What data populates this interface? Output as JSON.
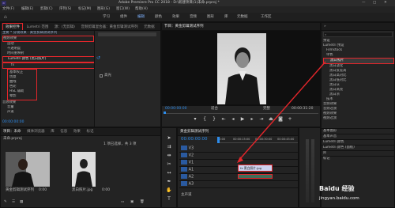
{
  "app": {
    "title": "Adobe Premiere Pro CC 2018 - D:\\新建项目(1)未命.prproj *",
    "window_controls": [
      "—",
      "□",
      "✕"
    ]
  },
  "menu": [
    "文件(F)",
    "编辑(E)",
    "剪辑(C)",
    "序列(S)",
    "标记(M)",
    "图形(G)",
    "窗口(W)",
    "帮助(H)"
  ],
  "workspaces": [
    "学习",
    "组件",
    "编辑",
    "颜色",
    "效果",
    "音频",
    "图形",
    "库",
    "元数据",
    "工作区"
  ],
  "effect_controls": {
    "tabs": [
      "效果控件",
      "Lumetri 范围",
      "源：(无剪辑)",
      "音频剪辑混合器：黄金剪辑测试序列",
      "元数据"
    ],
    "rows": [
      {
        "label": "主要 * 分镜效果 · 黄金剪辑测试序列",
        "indent": 0
      },
      {
        "label": "视频效果",
        "indent": 0
      },
      {
        "label": "运动",
        "indent": 1
      },
      {
        "label": "不透明度",
        "indent": 1
      },
      {
        "label": "时间重映射",
        "indent": 1
      },
      {
        "label": "Lumetri 颜色 (黑白照片)",
        "indent": 1
      },
      {
        "label": "fx",
        "indent": 2
      },
      {
        "label": "基本校正",
        "indent": 2
      },
      {
        "label": "创意",
        "indent": 2
      },
      {
        "label": "曲线",
        "indent": 2
      },
      {
        "label": "色轮",
        "indent": 2
      },
      {
        "label": "HSL 辅助",
        "indent": 2
      },
      {
        "label": "晕影",
        "indent": 2
      },
      {
        "label": "音频效果",
        "indent": 0
      },
      {
        "label": "音量",
        "indent": 1
      },
      {
        "label": "声道",
        "indent": 1
      }
    ],
    "highlight_label": "Lumetri 颜色 (黑白照片)",
    "checkbox_label": "高光",
    "timecode": "00:00:00:00"
  },
  "program": {
    "tab": "节目：黄金剪辑测试序列",
    "timecode_left": "00:00:00:00",
    "fit": "适合",
    "quality": "完整",
    "timecode_right": "00:00:31:20"
  },
  "effects_panel": {
    "search_placeholder": "",
    "items": [
      {
        "label": "预设",
        "indent": 0,
        "selected": false
      },
      {
        "label": "Lumetri 预设",
        "indent": 0,
        "selected": false
      },
      {
        "label": "Filmstock",
        "indent": 1,
        "selected": false
      },
      {
        "label": "单色",
        "indent": 1,
        "selected": false
      },
      {
        "label": "黑白照片",
        "indent": 2,
        "selected": true
      },
      {
        "label": "黑白淡化",
        "indent": 2,
        "selected": false
      },
      {
        "label": "黑白反差高",
        "indent": 2,
        "selected": false
      },
      {
        "label": "黑白高对比",
        "indent": 2,
        "selected": false
      },
      {
        "label": "黑白低对比",
        "indent": 2,
        "selected": false
      },
      {
        "label": "黑白灰",
        "indent": 2,
        "selected": false
      },
      {
        "label": "黑白高亮",
        "indent": 2,
        "selected": false
      },
      {
        "label": "黑白浓",
        "indent": 2,
        "selected": false
      },
      {
        "label": "技术",
        "indent": 1,
        "selected": false
      },
      {
        "label": "音频效果",
        "indent": 0,
        "selected": false
      },
      {
        "label": "音频过渡",
        "indent": 0,
        "selected": false
      },
      {
        "label": "视频效果",
        "indent": 0,
        "selected": false
      },
      {
        "label": "视频过渡",
        "indent": 0,
        "selected": false
      }
    ],
    "sections": [
      "基本图形",
      "基本声音",
      "Lumetri 颜色",
      "Lumetri 颜色 (面板)",
      "库",
      "标记"
    ]
  },
  "project": {
    "tabs": [
      "项目：未命",
      "媒体浏览器",
      "库",
      "信息",
      "效果",
      "标记"
    ],
    "file": "未命.prproj",
    "item_count": "1 项已选择，共 3 项",
    "clips": [
      {
        "name": "黄金剪辑测试序列",
        "duration": "0:00"
      },
      {
        "name": "黑白照片.jpg",
        "duration": "0:00"
      }
    ]
  },
  "timeline": {
    "tab": "黄金剪辑测试序列",
    "timecode": "00:00:00:00",
    "ruler": [
      "00:00",
      "00:00:15:00",
      "00:00:30:00",
      "00:00:45:00"
    ],
    "tracks": [
      "V3",
      "V2",
      "V1",
      "A1",
      "A2",
      "A3"
    ],
    "clip_label": "fx 黑白照片.jpg",
    "master": "主声道"
  },
  "watermark": {
    "brand": "Baidu 经验",
    "url": "jingyan.baidu.com"
  }
}
